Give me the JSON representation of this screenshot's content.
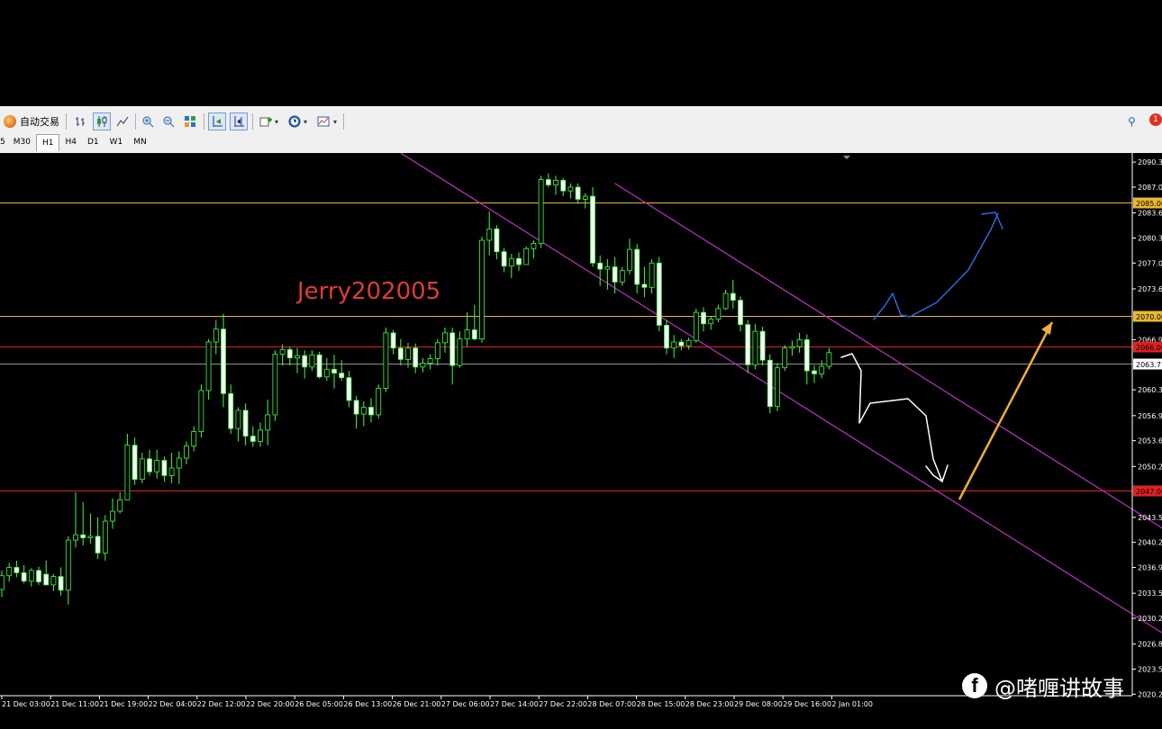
{
  "toolbar": {
    "auto_trade_label": "自动交易",
    "timeframes": [
      {
        "label": "5",
        "selected": false
      },
      {
        "label": "M30",
        "selected": false
      },
      {
        "label": "H1",
        "selected": true
      },
      {
        "label": "H4",
        "selected": false
      },
      {
        "label": "D1",
        "selected": false
      },
      {
        "label": "W1",
        "selected": false
      },
      {
        "label": "MN",
        "selected": false
      }
    ],
    "notification_count": "1"
  },
  "chart_data": {
    "type": "candlestick",
    "ylim": [
      2020.0,
      2091.5
    ],
    "y_ticks": [
      {
        "value": 2090.3,
        "label": "2090.30"
      },
      {
        "value": 2087.0,
        "label": "2087.00"
      },
      {
        "value": 2083.6,
        "label": "2083.60"
      },
      {
        "value": 2080.3,
        "label": "2080.30"
      },
      {
        "value": 2077.0,
        "label": "2077.00"
      },
      {
        "value": 2073.6,
        "label": "2073.60"
      },
      {
        "value": 2066.9,
        "label": "2066.90"
      },
      {
        "value": 2060.3,
        "label": "2060.30"
      },
      {
        "value": 2056.9,
        "label": "2056.90"
      },
      {
        "value": 2053.6,
        "label": "2053.60"
      },
      {
        "value": 2050.2,
        "label": "2050.20"
      },
      {
        "value": 2043.5,
        "label": "2043.50"
      },
      {
        "value": 2040.2,
        "label": "2040.20"
      },
      {
        "value": 2036.9,
        "label": "2036.90"
      },
      {
        "value": 2033.5,
        "label": "2033.50"
      },
      {
        "value": 2030.2,
        "label": "2030.20"
      },
      {
        "value": 2026.8,
        "label": "2026.80"
      },
      {
        "value": 2023.5,
        "label": "2023.50"
      },
      {
        "value": 2020.2,
        "label": "2020.20"
      }
    ],
    "x_labels": [
      "21 Dec 03:00",
      "21 Dec 11:00",
      "21 Dec 19:00",
      "22 Dec 04:00",
      "22 Dec 12:00",
      "22 Dec 20:00",
      "26 Dec 05:00",
      "26 Dec 13:00",
      "26 Dec 21:00",
      "27 Dec 06:00",
      "27 Dec 14:00",
      "27 Dec 22:00",
      "28 Dec 07:00",
      "28 Dec 15:00",
      "28 Dec 23:00",
      "29 Dec 08:00",
      "29 Dec 16:00",
      "2 Jan 01:00"
    ],
    "horizontal_lines": [
      {
        "price": 2085.0,
        "label": "2085.00",
        "color": "#e8b830",
        "label_bg": "#e8b830"
      },
      {
        "price": 2070.0,
        "label": "2070.00",
        "color": "#e8b830",
        "label_bg": "#e8b830"
      },
      {
        "price": 2066.0,
        "label": "2066.00",
        "color": "#e02020",
        "label_bg": "#e02020"
      },
      {
        "price": 2063.7,
        "label": "2063.71",
        "color": "#909090",
        "label_bg": "#ffffff"
      },
      {
        "price": 2047.0,
        "label": "2047.00",
        "color": "#e02020",
        "label_bg": "#e02020"
      }
    ],
    "channel": {
      "color": "#c030c0",
      "upper": [
        {
          "bar": 83,
          "price": 2087.5
        },
        {
          "bar": 160,
          "price": 2040.3
        }
      ],
      "lower": [
        {
          "bar": 54,
          "price": 2091.5
        },
        {
          "bar": 160,
          "price": 2026.5
        }
      ]
    },
    "annotation_text": "Jerry202005",
    "candle_color": "#ffffff",
    "candle_color_bull": "#3cff3c",
    "bars": [
      [
        2034.0,
        2036.5,
        2033.0,
        2035.8
      ],
      [
        2035.8,
        2037.5,
        2035.0,
        2036.9
      ],
      [
        2036.9,
        2037.8,
        2035.6,
        2036.2
      ],
      [
        2036.2,
        2037.2,
        2034.8,
        2035.1
      ],
      [
        2035.1,
        2036.8,
        2034.4,
        2036.5
      ],
      [
        2036.5,
        2037.0,
        2034.6,
        2035.0
      ],
      [
        2036.0,
        2037.8,
        2035.2,
        2034.6
      ],
      [
        2034.6,
        2036.0,
        2033.8,
        2035.7
      ],
      [
        2035.7,
        2036.9,
        2033.2,
        2033.9
      ],
      [
        2033.9,
        2041.0,
        2032.0,
        2040.5
      ],
      [
        2040.5,
        2046.8,
        2039.5,
        2041.2
      ],
      [
        2041.2,
        2045.5,
        2039.8,
        2040.8
      ],
      [
        2040.8,
        2044.0,
        2040.0,
        2041.0
      ],
      [
        2041.0,
        2043.5,
        2038.0,
        2038.8
      ],
      [
        2038.8,
        2043.8,
        2037.8,
        2043.0
      ],
      [
        2043.0,
        2046.0,
        2042.0,
        2044.3
      ],
      [
        2044.3,
        2046.8,
        2044.0,
        2045.8
      ],
      [
        2045.8,
        2054.5,
        2047.0,
        2053.0
      ],
      [
        2053.0,
        2054.0,
        2047.8,
        2048.5
      ],
      [
        2048.5,
        2052.0,
        2048.0,
        2051.2
      ],
      [
        2051.2,
        2052.4,
        2049.0,
        2049.5
      ],
      [
        2049.5,
        2052.4,
        2048.6,
        2051.0
      ],
      [
        2051.0,
        2051.5,
        2048.2,
        2049.0
      ],
      [
        2049.0,
        2052.0,
        2048.0,
        2050.0
      ],
      [
        2050.0,
        2052.2,
        2047.9,
        2051.3
      ],
      [
        2051.3,
        2053.5,
        2050.5,
        2052.9
      ],
      [
        2052.9,
        2055.5,
        2052.2,
        2054.8
      ],
      [
        2054.8,
        2061.0,
        2054.0,
        2060.2
      ],
      [
        2060.2,
        2067.0,
        2059.0,
        2066.6
      ],
      [
        2066.6,
        2069.5,
        2065.0,
        2068.3
      ],
      [
        2068.3,
        2070.3,
        2058.0,
        2059.8
      ],
      [
        2059.8,
        2061.0,
        2054.5,
        2055.2
      ],
      [
        2055.2,
        2058.0,
        2053.5,
        2057.6
      ],
      [
        2057.6,
        2058.5,
        2053.0,
        2054.2
      ],
      [
        2054.2,
        2055.5,
        2052.8,
        2053.5
      ],
      [
        2053.5,
        2056.0,
        2052.8,
        2055.0
      ],
      [
        2055.0,
        2059.0,
        2053.0,
        2057.0
      ],
      [
        2057.0,
        2065.5,
        2056.2,
        2065.0
      ],
      [
        2065.0,
        2066.3,
        2063.5,
        2065.6
      ],
      [
        2065.6,
        2066.0,
        2063.5,
        2064.5
      ],
      [
        2064.5,
        2065.8,
        2062.5,
        2064.8
      ],
      [
        2064.8,
        2065.5,
        2061.8,
        2063.3
      ],
      [
        2063.3,
        2065.5,
        2062.8,
        2064.9
      ],
      [
        2064.9,
        2065.3,
        2061.8,
        2062.0
      ],
      [
        2062.0,
        2064.5,
        2061.5,
        2063.0
      ],
      [
        2063.0,
        2064.9,
        2060.5,
        2062.5
      ],
      [
        2062.5,
        2064.2,
        2061.5,
        2061.9
      ],
      [
        2061.9,
        2062.8,
        2058.0,
        2058.9
      ],
      [
        2058.9,
        2059.5,
        2055.2,
        2057.1
      ],
      [
        2057.1,
        2058.8,
        2055.5,
        2058.0
      ],
      [
        2058.0,
        2059.2,
        2056.0,
        2057.0
      ],
      [
        2057.0,
        2061.0,
        2056.5,
        2060.5
      ],
      [
        2060.5,
        2068.5,
        2060.0,
        2067.8
      ],
      [
        2067.8,
        2068.2,
        2065.0,
        2065.8
      ],
      [
        2065.8,
        2067.0,
        2063.5,
        2064.3
      ],
      [
        2064.3,
        2066.5,
        2063.2,
        2065.8
      ],
      [
        2065.8,
        2066.4,
        2062.5,
        2063.3
      ],
      [
        2063.3,
        2064.5,
        2062.6,
        2063.8
      ],
      [
        2063.8,
        2065.0,
        2063.0,
        2064.4
      ],
      [
        2064.4,
        2067.0,
        2063.5,
        2066.5
      ],
      [
        2066.5,
        2068.5,
        2065.2,
        2067.8
      ],
      [
        2067.8,
        2068.5,
        2061.0,
        2063.5
      ],
      [
        2063.5,
        2068.0,
        2063.2,
        2067.0
      ],
      [
        2067.0,
        2070.5,
        2066.0,
        2068.2
      ],
      [
        2068.2,
        2071.5,
        2066.8,
        2067.0
      ],
      [
        2067.0,
        2080.5,
        2066.5,
        2080.0
      ],
      [
        2080.0,
        2083.8,
        2078.0,
        2081.5
      ],
      [
        2081.5,
        2082.0,
        2077.5,
        2078.5
      ],
      [
        2078.5,
        2079.0,
        2075.8,
        2076.6
      ],
      [
        2076.6,
        2078.2,
        2075.0,
        2077.6
      ],
      [
        2077.6,
        2078.4,
        2076.0,
        2076.8
      ],
      [
        2076.8,
        2079.2,
        2077.0,
        2078.9
      ],
      [
        2078.9,
        2080.0,
        2077.6,
        2079.6
      ],
      [
        2079.6,
        2088.5,
        2079.0,
        2088.0
      ],
      [
        2088.0,
        2088.8,
        2087.0,
        2087.3
      ],
      [
        2087.3,
        2088.5,
        2086.0,
        2087.9
      ],
      [
        2087.9,
        2088.2,
        2085.8,
        2086.5
      ],
      [
        2086.5,
        2087.5,
        2085.5,
        2087.0
      ],
      [
        2087.0,
        2087.5,
        2084.8,
        2085.4
      ],
      [
        2085.4,
        2086.2,
        2084.2,
        2085.8
      ],
      [
        2085.8,
        2087.0,
        2076.5,
        2077.0
      ],
      [
        2077.0,
        2078.0,
        2074.0,
        2076.2
      ],
      [
        2076.2,
        2077.5,
        2073.5,
        2076.5
      ],
      [
        2076.5,
        2077.8,
        2073.0,
        2074.5
      ],
      [
        2074.5,
        2076.5,
        2074.0,
        2076.0
      ],
      [
        2076.0,
        2080.2,
        2075.5,
        2078.8
      ],
      [
        2078.8,
        2079.5,
        2073.0,
        2074.2
      ],
      [
        2074.2,
        2076.5,
        2072.5,
        2073.8
      ],
      [
        2073.8,
        2077.5,
        2073.0,
        2077.0
      ],
      [
        2077.0,
        2077.8,
        2068.0,
        2068.8
      ],
      [
        2068.8,
        2069.5,
        2065.0,
        2065.8
      ],
      [
        2065.8,
        2067.5,
        2064.5,
        2066.6
      ],
      [
        2066.6,
        2067.0,
        2065.5,
        2066.1
      ],
      [
        2066.1,
        2067.2,
        2065.6,
        2066.8
      ],
      [
        2066.8,
        2071.0,
        2066.5,
        2070.5
      ],
      [
        2070.5,
        2071.2,
        2068.0,
        2069.0
      ],
      [
        2069.0,
        2070.0,
        2068.2,
        2069.6
      ],
      [
        2069.6,
        2071.5,
        2069.2,
        2071.0
      ],
      [
        2071.0,
        2073.5,
        2070.8,
        2073.0
      ],
      [
        2073.0,
        2074.8,
        2071.0,
        2072.1
      ],
      [
        2072.1,
        2072.6,
        2068.0,
        2068.9
      ],
      [
        2068.9,
        2069.5,
        2062.5,
        2063.6
      ],
      [
        2063.6,
        2069.0,
        2063.0,
        2068.0
      ],
      [
        2068.0,
        2068.6,
        2063.5,
        2064.2
      ],
      [
        2064.2,
        2065.0,
        2057.2,
        2058.1
      ],
      [
        2058.1,
        2063.8,
        2057.5,
        2063.2
      ],
      [
        2063.2,
        2066.2,
        2062.8,
        2065.8
      ],
      [
        2065.8,
        2066.8,
        2064.8,
        2066.0
      ],
      [
        2066.0,
        2067.8,
        2065.2,
        2066.9
      ],
      [
        2066.9,
        2067.6,
        2061.0,
        2062.8
      ],
      [
        2062.8,
        2063.5,
        2061.2,
        2062.4
      ],
      [
        2062.4,
        2064.2,
        2061.8,
        2063.4
      ],
      [
        2063.4,
        2065.8,
        2063.0,
        2065.2
      ]
    ],
    "drawings": {
      "white_path": [
        [
          934,
          397
        ],
        [
          946,
          393
        ],
        [
          956,
          412
        ],
        [
          954,
          470
        ],
        [
          966,
          448
        ],
        [
          1008,
          443
        ],
        [
          1028,
          462
        ],
        [
          1036,
          510
        ],
        [
          1040,
          520
        ],
        [
          1046,
          535
        ],
        [
          1052,
          517
        ]
      ],
      "white_arrow_head": [
        [
          1028,
          518
        ],
        [
          1036,
          528
        ],
        [
          1046,
          535
        ]
      ],
      "blue_path": [
        [
          970,
          355
        ],
        [
          982,
          340
        ],
        [
          991,
          326
        ],
        [
          1000,
          350
        ],
        [
          1010,
          352
        ],
        [
          1040,
          336
        ],
        [
          1075,
          300
        ],
        [
          1100,
          255
        ],
        [
          1108,
          237
        ]
      ],
      "blue_arrow_head": [
        [
          1090,
          238
        ],
        [
          1105,
          236
        ],
        [
          1113,
          254
        ]
      ],
      "yellow_arrow": {
        "from": [
          1065,
          555
        ],
        "to": [
          1168,
          358
        ],
        "color": "#f0b030"
      }
    }
  },
  "watermark": {
    "text": "@啫喱讲故事"
  }
}
